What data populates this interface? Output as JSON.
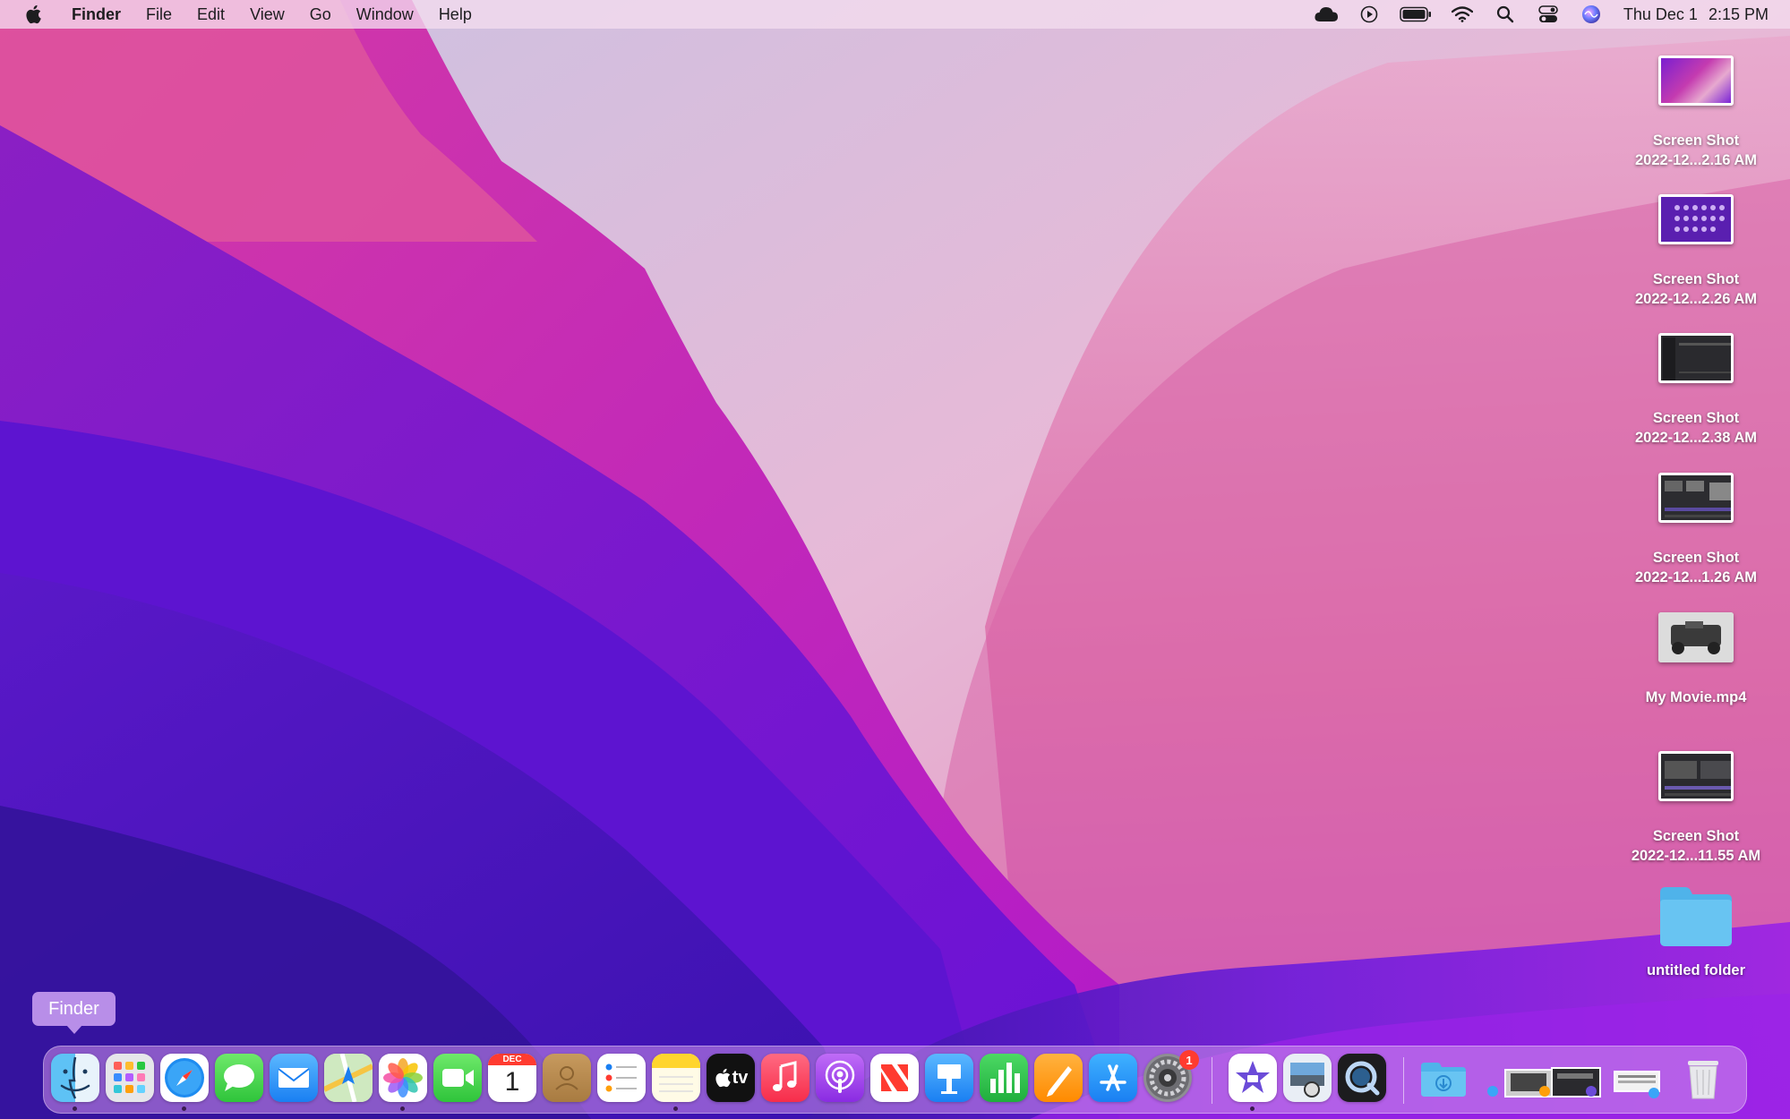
{
  "menubar": {
    "app_name": "Finder",
    "menus": [
      "File",
      "Edit",
      "View",
      "Go",
      "Window",
      "Help"
    ],
    "clock": {
      "date": "Thu Dec 1",
      "time": "2:15 PM"
    }
  },
  "desktop": {
    "items": [
      {
        "line1": "Screen Shot",
        "line2": "2022-12...2.16 AM"
      },
      {
        "line1": "Screen Shot",
        "line2": "2022-12...2.26 AM"
      },
      {
        "line1": "Screen Shot",
        "line2": "2022-12...2.38 AM"
      },
      {
        "line1": "Screen Shot",
        "line2": "2022-12...1.26 AM"
      },
      {
        "line1": "My Movie.mp4",
        "line2": ""
      },
      {
        "line1": "Screen Shot",
        "line2": "2022-12...11.55 AM"
      },
      {
        "line1": "untitled folder",
        "line2": ""
      }
    ]
  },
  "tooltip": {
    "text": "Finder"
  },
  "dock": {
    "calendar": {
      "month": "DEC",
      "day": "1"
    },
    "appletv_label": "tv",
    "settings_badge": "1"
  }
}
